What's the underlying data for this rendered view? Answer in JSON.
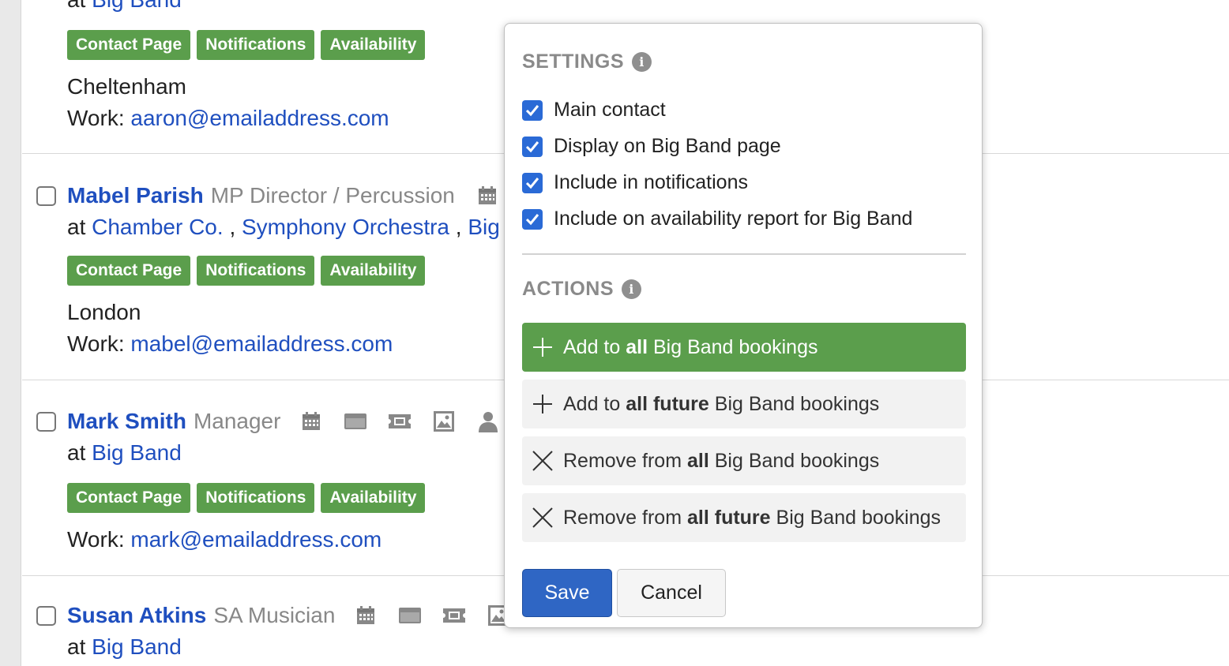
{
  "contacts": [
    {
      "at_prefix": "at",
      "orgs": [
        "Big Band"
      ],
      "tags": [
        "Contact Page",
        "Notifications",
        "Availability"
      ],
      "location": "Cheltenham",
      "email_label": "Work:",
      "email": "aaron@emailaddress.com"
    },
    {
      "name": "Mabel Parish",
      "role": "MP Director / Percussion",
      "at_prefix": "at",
      "orgs": [
        "Chamber Co.",
        "Symphony Orchestra",
        "Big"
      ],
      "org_sep": ",",
      "tags": [
        "Contact Page",
        "Notifications",
        "Availability"
      ],
      "location": "London",
      "email_label": "Work:",
      "email": "mabel@emailaddress.com"
    },
    {
      "name": "Mark Smith",
      "role": "Manager",
      "at_prefix": "at",
      "orgs": [
        "Big Band"
      ],
      "tags": [
        "Contact Page",
        "Notifications",
        "Availability"
      ],
      "email_label": "Work:",
      "email": "mark@emailaddress.com"
    },
    {
      "name": "Susan Atkins",
      "role": "SA Musician",
      "at_prefix": "at",
      "orgs": [
        "Big Band"
      ]
    }
  ],
  "icons": [
    "calendar-icon",
    "window-icon",
    "ticket-icon",
    "image-icon",
    "person-icon"
  ],
  "popover": {
    "settings_title": "SETTINGS",
    "settings": [
      {
        "label": "Main contact",
        "checked": true
      },
      {
        "label": "Display on Big Band page",
        "checked": true
      },
      {
        "label": "Include in notifications",
        "checked": true
      },
      {
        "label": "Include on availability report for Big Band",
        "checked": true
      }
    ],
    "actions_title": "ACTIONS",
    "actions": [
      {
        "icon": "plus-icon",
        "pre": "Add to",
        "bold": "all",
        "post": "Big Band bookings",
        "primary": true
      },
      {
        "icon": "plus-icon",
        "pre": "Add to",
        "bold": "all future",
        "post": "Big Band bookings",
        "primary": false
      },
      {
        "icon": "x-icon",
        "pre": "Remove from",
        "bold": "all",
        "post": "Big Band bookings",
        "primary": false
      },
      {
        "icon": "x-icon",
        "pre": "Remove from",
        "bold": "all future",
        "post": "Big Band bookings",
        "primary": false
      }
    ],
    "save_label": "Save",
    "cancel_label": "Cancel",
    "info_glyph": "i"
  },
  "colors": {
    "link": "#1f4fbf",
    "tag_green": "#5b9e4c",
    "checkbox_blue": "#2a6ad6",
    "save_blue": "#2f66c4"
  }
}
